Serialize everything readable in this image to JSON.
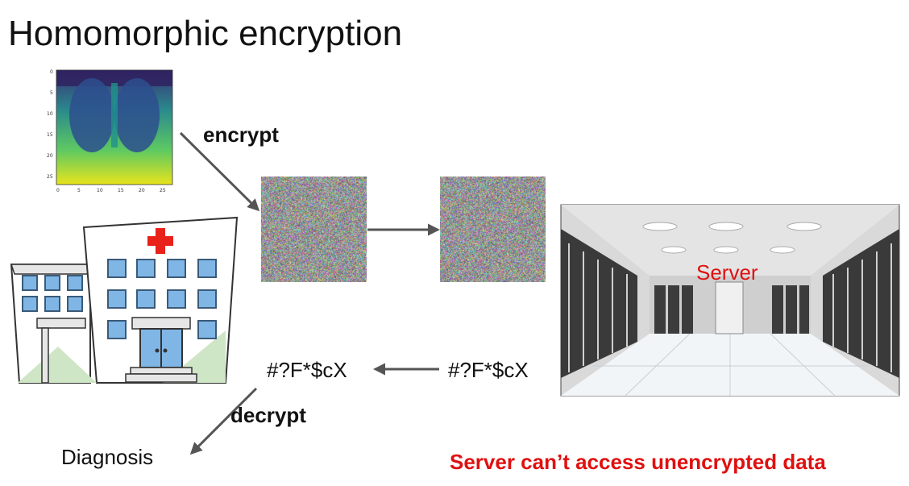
{
  "title": "Homomorphic encryption",
  "labels": {
    "encrypt": "encrypt",
    "decrypt": "decrypt",
    "server": "Server",
    "cipher_server": "#?F*$cX",
    "cipher_client": "#?F*$cX",
    "diagnosis": "Diagnosis",
    "footer_note": "Server can’t access unencrypted data"
  },
  "xray_axes": {
    "y_ticks": [
      "0",
      "5",
      "10",
      "15",
      "20",
      "25"
    ],
    "x_ticks": [
      "0",
      "5",
      "10",
      "15",
      "20",
      "25"
    ]
  },
  "colors": {
    "note": "#e01010",
    "arrow": "#555555",
    "hospital_cross": "#e8221a",
    "window": "#7fb6e6"
  }
}
